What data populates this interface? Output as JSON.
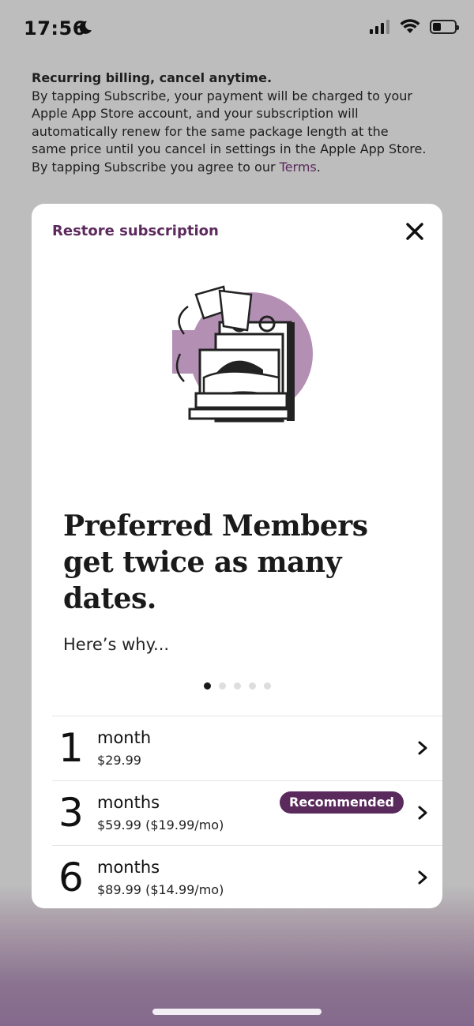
{
  "status_bar": {
    "time": "17:56"
  },
  "notice": {
    "heading": "Recurring billing, cancel anytime.",
    "body": "By tapping Subscribe, your payment will be charged to your Apple App Store account, and your subscription will automatically renew for the same package length at the same price until you cancel in settings in the Apple App Store. By tapping Subscribe you agree to our ",
    "terms_link": "Terms",
    "trailing": "."
  },
  "card": {
    "restore_label": "Restore subscription",
    "headline": "Preferred Members get twice as many dates.",
    "subline": "Here’s why...",
    "carousel": {
      "page_count": 5,
      "active_index": 0
    },
    "plans": [
      {
        "number": "1",
        "label": "month",
        "price": "$29.99",
        "badge": ""
      },
      {
        "number": "3",
        "label": "months",
        "price": "$59.99 ($19.99/mo)",
        "badge": "Recommended"
      },
      {
        "number": "6",
        "label": "months",
        "price": "$89.99 ($14.99/mo)",
        "badge": ""
      }
    ]
  },
  "colors": {
    "accent": "#5a2a5c",
    "illustration_blob": "#b48fb4",
    "page_background": "#bdbdbd",
    "card_background": "#ffffff"
  },
  "icons": {
    "close": "close-icon",
    "chevron": "chevron-right-icon",
    "moon": "moon-icon",
    "signal": "cellular-signal-icon",
    "wifi": "wifi-icon",
    "battery": "battery-icon"
  }
}
